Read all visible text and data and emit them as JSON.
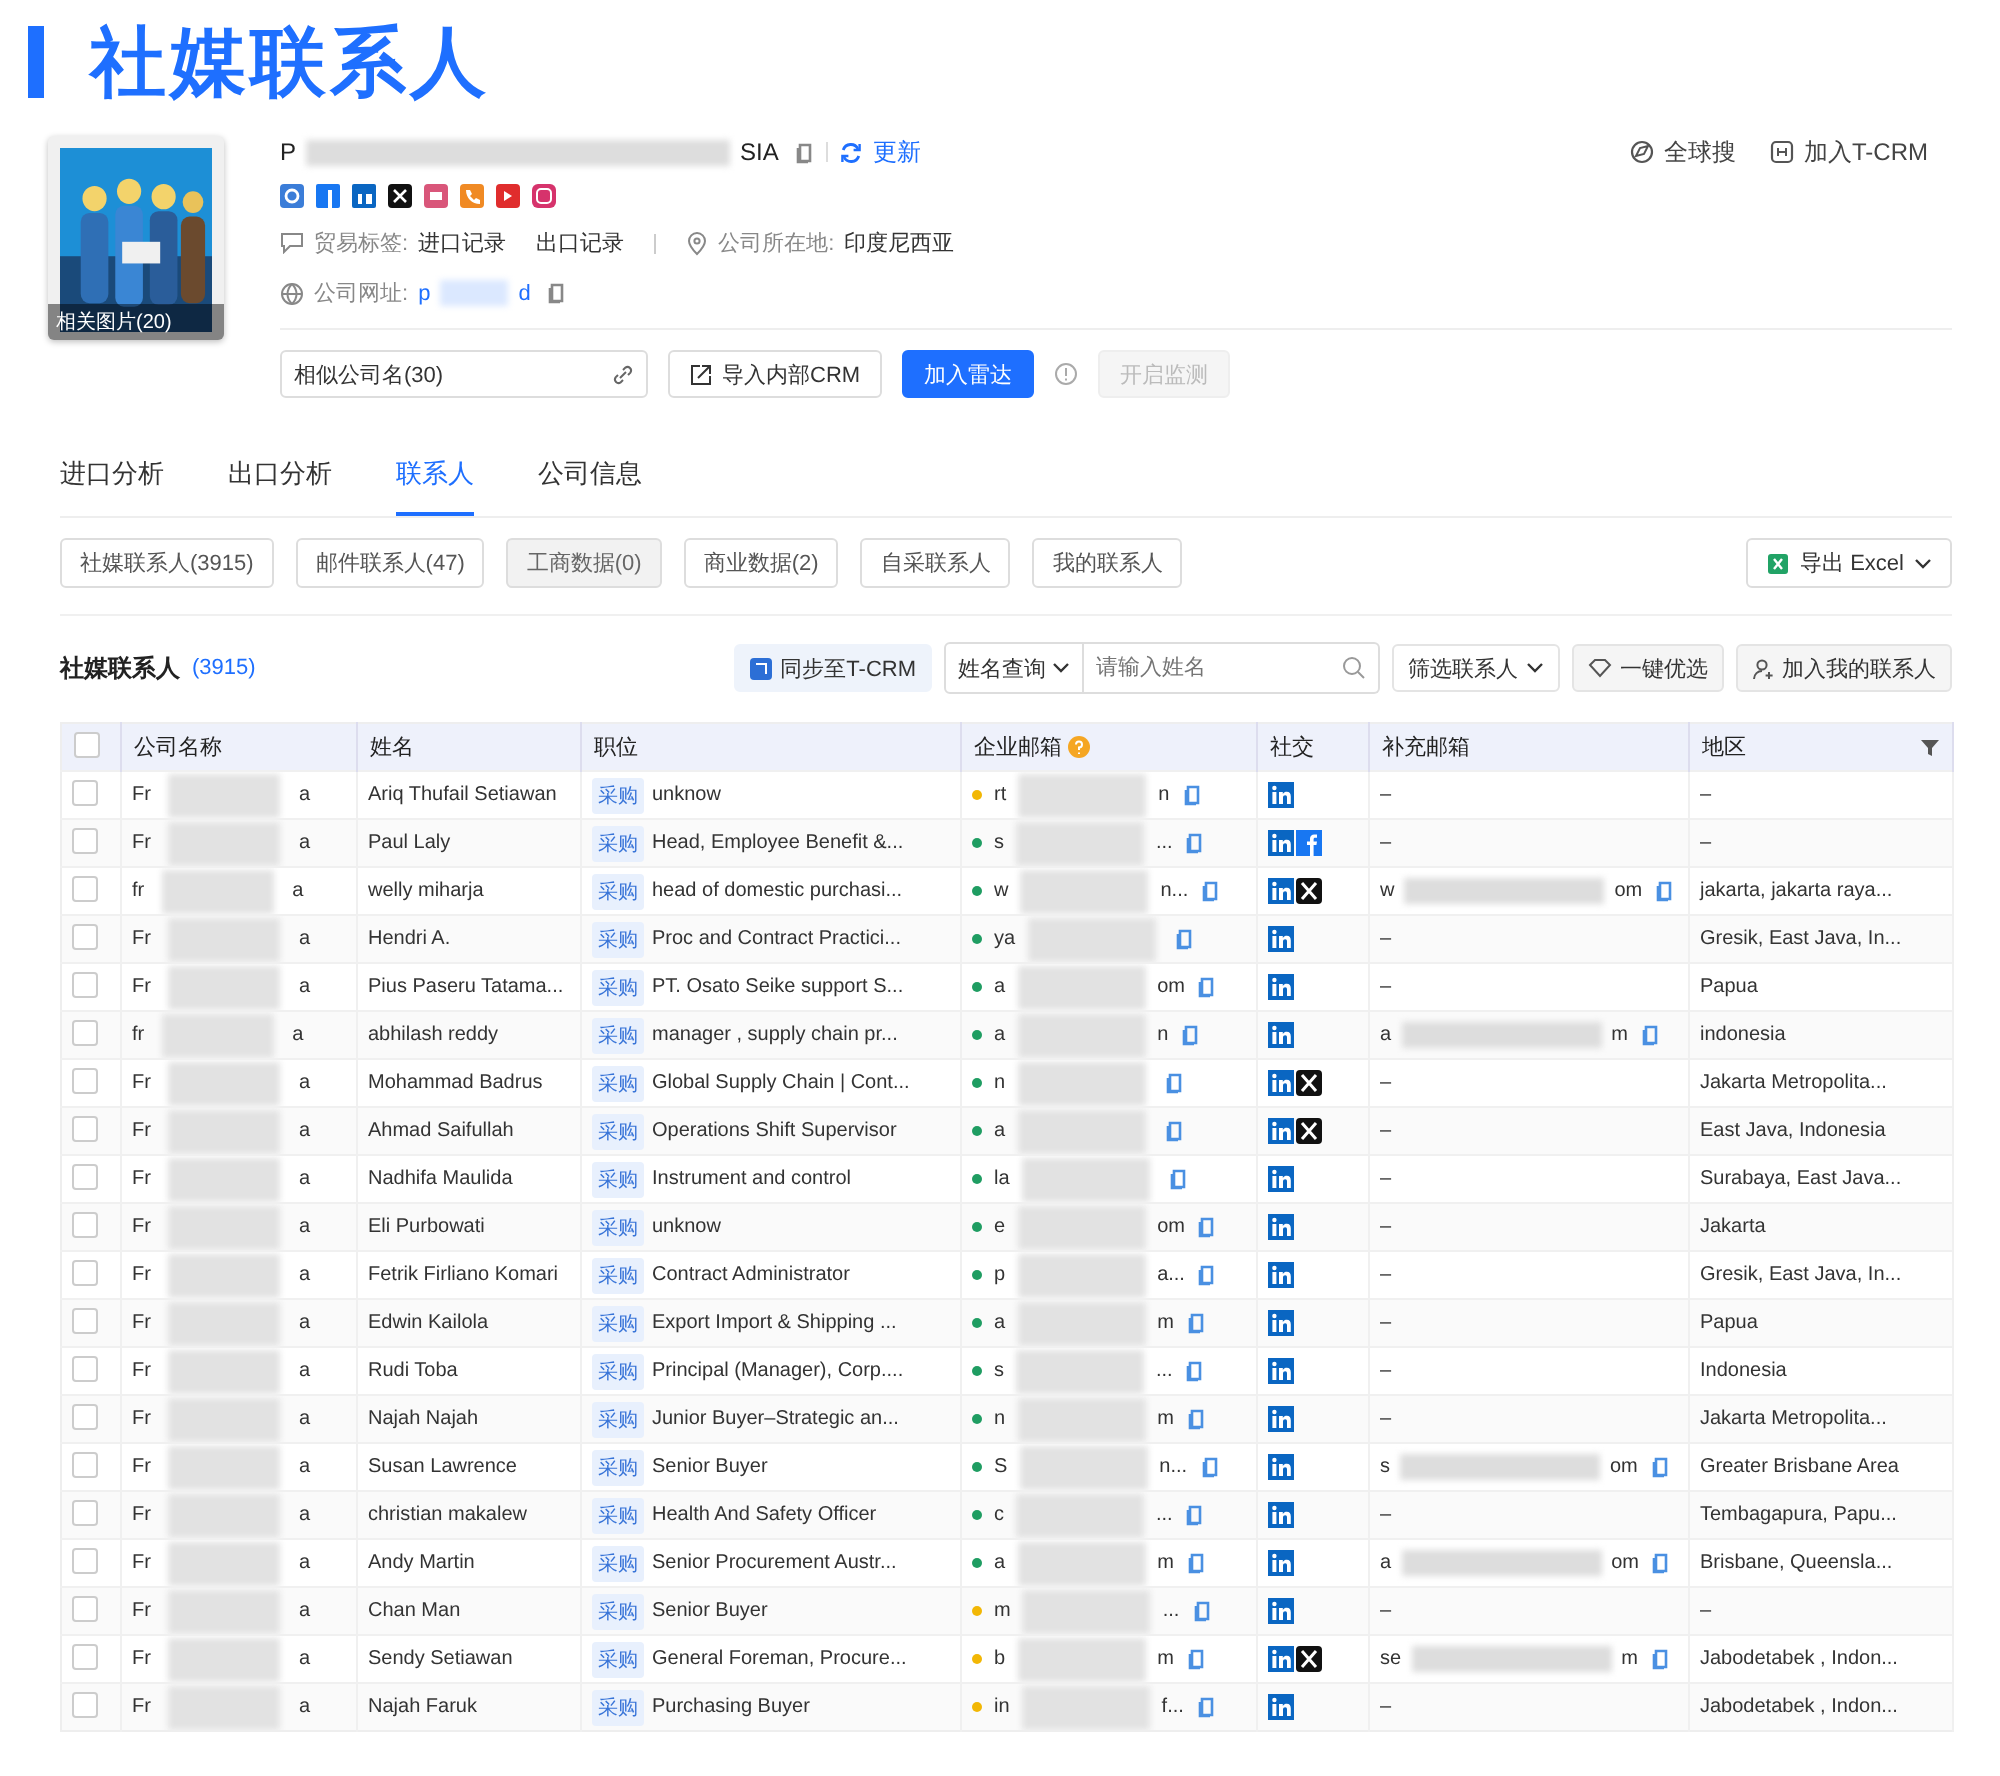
{
  "page_title": "社媒联系人",
  "company": {
    "name_start": "P",
    "name_end": "SIA",
    "refresh": "更新",
    "photo_caption": "相关图片(20)",
    "trade_label": "贸易标签:",
    "trade_tags": [
      "进口记录",
      "出口记录"
    ],
    "location_label": "公司所在地:",
    "location": "印度尼西亚",
    "website_label": "公司网址:",
    "website_start": "p",
    "website_end": "d",
    "actions": [
      "全球搜",
      "加入T-CRM"
    ]
  },
  "toolbar": {
    "similar": "相似公司名(30)",
    "import_crm": "导入内部CRM",
    "radar": "加入雷达",
    "monitor": {
      "label": "开启监测",
      "disabled": true
    }
  },
  "tabs": [
    {
      "label": "进口分析",
      "selected": false
    },
    {
      "label": "出口分析",
      "selected": false
    },
    {
      "label": "联系人",
      "selected": true
    },
    {
      "label": "公司信息",
      "selected": false
    }
  ],
  "chips": [
    {
      "label": "社媒联系人(3915)",
      "disabled": false
    },
    {
      "label": "邮件联系人(47)",
      "disabled": false
    },
    {
      "label": "工商数据(0)",
      "disabled": true
    },
    {
      "label": "商业数据(2)",
      "disabled": false
    },
    {
      "label": "自采联系人",
      "disabled": false
    },
    {
      "label": "我的联系人",
      "disabled": false
    }
  ],
  "export": "导出 Excel",
  "section": {
    "title": "社媒联系人",
    "count": "(3915)",
    "sync": "同步至T-CRM",
    "search_mode": "姓名查询",
    "search_placeholder": "请输入姓名",
    "filter": "筛选联系人",
    "optimize": "一键优选",
    "add_mine": "加入我的联系人"
  },
  "table": {
    "all_checked": false,
    "columns": [
      "公司名称",
      "姓名",
      "职位",
      "企业邮箱",
      "社交",
      "补充邮箱",
      "地区"
    ]
  },
  "rows": [
    {
      "checked": false,
      "company_start": "Fr",
      "company_end": "a",
      "name": "Ariq Thufail Setiawan",
      "tag": "采购",
      "position": "unknow",
      "color": "#f2b705",
      "email_start": "rt",
      "email_end": "n",
      "social": [
        {
          "kind": "linkedin"
        }
      ],
      "extra": "–",
      "region": "–"
    },
    {
      "checked": false,
      "company_start": "Fr",
      "company_end": "a",
      "name": "Paul Laly",
      "tag": "采购",
      "position": "Head, Employee Benefit &...",
      "color": "#1f9d62",
      "email_start": "s",
      "email_end": "...",
      "social": [
        {
          "kind": "linkedin"
        },
        {
          "kind": "facebook"
        }
      ],
      "extra": "–",
      "region": "–"
    },
    {
      "checked": false,
      "company_start": "fr",
      "company_end": "a",
      "name": "welly miharja",
      "tag": "采购",
      "position": "head of domestic purchasi...",
      "color": "#1f9d62",
      "email_start": "w",
      "email_end": "n...",
      "social": [
        {
          "kind": "linkedin"
        },
        {
          "kind": "x"
        }
      ],
      "extra_start": "w",
      "extra_end": "om",
      "region": "jakarta, jakarta raya..."
    },
    {
      "checked": false,
      "company_start": "Fr",
      "company_end": "a",
      "name": "Hendri A.",
      "tag": "采购",
      "position": "Proc and Contract Practici...",
      "color": "#1f9d62",
      "email_start": "ya",
      "social": [
        {
          "kind": "linkedin"
        }
      ],
      "extra": "–",
      "region": "Gresik, East Java, In..."
    },
    {
      "checked": false,
      "company_start": "Fr",
      "company_end": "a",
      "name": "Pius Paseru Tatama...",
      "tag": "采购",
      "position": "PT. Osato Seike support S...",
      "color": "#1f9d62",
      "email_start": "a",
      "email_end": "om",
      "social": [
        {
          "kind": "linkedin"
        }
      ],
      "extra": "–",
      "region": "Papua"
    },
    {
      "checked": false,
      "company_start": "fr",
      "company_end": "a",
      "name": "abhilash reddy",
      "tag": "采购",
      "position": "manager , supply chain pr...",
      "color": "#1f9d62",
      "email_start": "a",
      "email_end": "n",
      "social": [
        {
          "kind": "linkedin"
        }
      ],
      "extra_start": "a",
      "extra_end": "m",
      "region": "indonesia"
    },
    {
      "checked": false,
      "company_start": "Fr",
      "company_end": "a",
      "name": "Mohammad Badrus",
      "tag": "采购",
      "position": "Global Supply Chain | Cont...",
      "color": "#1f9d62",
      "email_start": "n",
      "social": [
        {
          "kind": "linkedin"
        },
        {
          "kind": "x"
        }
      ],
      "extra": "–",
      "region": "Jakarta Metropolita..."
    },
    {
      "checked": false,
      "company_start": "Fr",
      "company_end": "a",
      "name": "Ahmad Saifullah",
      "tag": "采购",
      "position": "Operations Shift Supervisor",
      "color": "#1f9d62",
      "email_start": "a",
      "social": [
        {
          "kind": "linkedin"
        },
        {
          "kind": "x"
        }
      ],
      "extra": "–",
      "region": "East Java, Indonesia"
    },
    {
      "checked": false,
      "company_start": "Fr",
      "company_end": "a",
      "name": "Nadhifa Maulida",
      "tag": "采购",
      "position": "Instrument and control",
      "color": "#1f9d62",
      "email_start": "la",
      "social": [
        {
          "kind": "linkedin"
        }
      ],
      "extra": "–",
      "region": "Surabaya, East Java..."
    },
    {
      "checked": false,
      "company_start": "Fr",
      "company_end": "a",
      "name": "Eli Purbowati",
      "tag": "采购",
      "position": "unknow",
      "color": "#1f9d62",
      "email_start": "e",
      "email_end": "om",
      "social": [
        {
          "kind": "linkedin"
        }
      ],
      "extra": "–",
      "region": "Jakarta"
    },
    {
      "checked": false,
      "company_start": "Fr",
      "company_end": "a",
      "name": "Fetrik Firliano Komari",
      "tag": "采购",
      "position": "Contract Administrator",
      "color": "#1f9d62",
      "email_start": "p",
      "email_end": "a...",
      "social": [
        {
          "kind": "linkedin"
        }
      ],
      "extra": "–",
      "region": "Gresik, East Java, In..."
    },
    {
      "checked": false,
      "company_start": "Fr",
      "company_end": "a",
      "name": "Edwin Kailola",
      "tag": "采购",
      "position": "Export Import & Shipping ...",
      "color": "#1f9d62",
      "email_start": "a",
      "email_end": "m",
      "social": [
        {
          "kind": "linkedin"
        }
      ],
      "extra": "–",
      "region": "Papua"
    },
    {
      "checked": false,
      "company_start": "Fr",
      "company_end": "a",
      "name": "Rudi Toba",
      "tag": "采购",
      "position": "Principal (Manager), Corp....",
      "color": "#1f9d62",
      "email_start": "s",
      "email_end": "...",
      "social": [
        {
          "kind": "linkedin"
        }
      ],
      "extra": "–",
      "region": "Indonesia"
    },
    {
      "checked": false,
      "company_start": "Fr",
      "company_end": "a",
      "name": "Najah Najah",
      "tag": "采购",
      "position": "Junior Buyer–Strategic an...",
      "color": "#1f9d62",
      "email_start": "n",
      "email_end": "m",
      "social": [
        {
          "kind": "linkedin"
        }
      ],
      "extra": "–",
      "region": "Jakarta Metropolita..."
    },
    {
      "checked": false,
      "company_start": "Fr",
      "company_end": "a",
      "name": "Susan Lawrence",
      "tag": "采购",
      "position": "Senior Buyer",
      "color": "#1f9d62",
      "email_start": "S",
      "email_end": "n...",
      "social": [
        {
          "kind": "linkedin"
        }
      ],
      "extra_start": "s",
      "extra_end": "om",
      "region": "Greater Brisbane Area"
    },
    {
      "checked": false,
      "company_start": "Fr",
      "company_end": "a",
      "name": "christian makalew",
      "tag": "采购",
      "position": "Health And Safety Officer",
      "color": "#1f9d62",
      "email_start": "c",
      "email_end": "...",
      "social": [
        {
          "kind": "linkedin"
        }
      ],
      "extra": "–",
      "region": "Tembagapura, Papu..."
    },
    {
      "checked": false,
      "company_start": "Fr",
      "company_end": "a",
      "name": "Andy Martin",
      "tag": "采购",
      "position": "Senior Procurement Austr...",
      "color": "#1f9d62",
      "email_start": "a",
      "email_end": "m",
      "social": [
        {
          "kind": "linkedin"
        }
      ],
      "extra_start": "a",
      "extra_end": "om",
      "region": "Brisbane, Queensla..."
    },
    {
      "checked": false,
      "company_start": "Fr",
      "company_end": "a",
      "name": "Chan Man",
      "tag": "采购",
      "position": "Senior Buyer",
      "color": "#f2b705",
      "email_start": "m",
      "email_end": "...",
      "social": [
        {
          "kind": "linkedin"
        }
      ],
      "extra": "–",
      "region": "–"
    },
    {
      "checked": false,
      "company_start": "Fr",
      "company_end": "a",
      "name": "Sendy Setiawan",
      "tag": "采购",
      "position": "General Foreman, Procure...",
      "color": "#f2b705",
      "email_start": "b",
      "email_end": "m",
      "social": [
        {
          "kind": "linkedin"
        },
        {
          "kind": "x"
        }
      ],
      "extra_start": "se",
      "extra_end": "m",
      "region": "Jabodetabek , Indon..."
    },
    {
      "checked": false,
      "company_start": "Fr",
      "company_end": "a",
      "name": "Najah Faruk",
      "tag": "采购",
      "position": "Purchasing Buyer",
      "color": "#f2b705",
      "email_start": "in",
      "email_end": "f...",
      "social": [
        {
          "kind": "linkedin"
        }
      ],
      "extra": "–",
      "region": "Jabodetabek , Indon..."
    }
  ]
}
